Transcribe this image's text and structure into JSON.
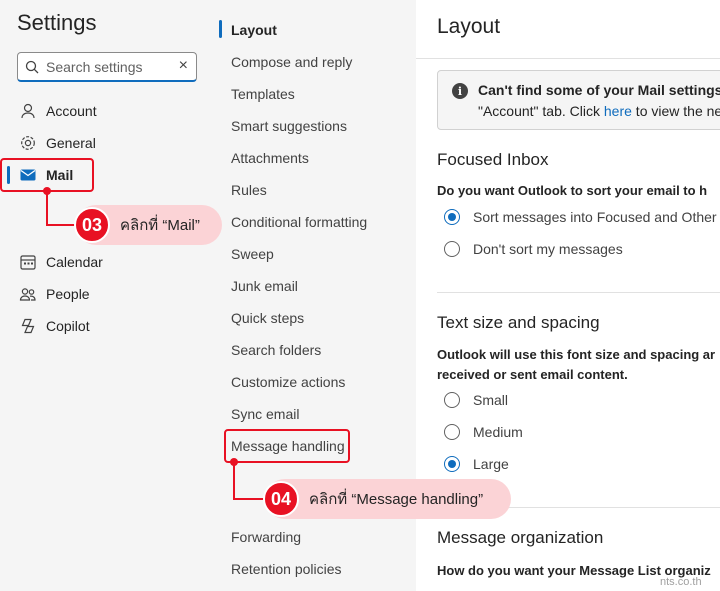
{
  "settings": {
    "title": "Settings",
    "search_placeholder": "Search settings"
  },
  "nav": {
    "account": "Account",
    "general": "General",
    "mail": "Mail",
    "calendar": "Calendar",
    "people": "People",
    "copilot": "Copilot"
  },
  "submenu": [
    "Layout",
    "Compose and reply",
    "Templates",
    "Smart suggestions",
    "Attachments",
    "Rules",
    "Conditional formatting",
    "Sweep",
    "Junk email",
    "Quick steps",
    "Search folders",
    "Customize actions",
    "Sync email",
    "Message handling",
    "Forwarding",
    "Retention policies"
  ],
  "panel": {
    "title": "Layout",
    "info": {
      "title": "Can't find some of your Mail settings?",
      "line2_pre": "\"Account\" tab. Click ",
      "line2_link": "here",
      "line2_post": " to view the ne"
    },
    "focused_inbox": {
      "title": "Focused Inbox",
      "desc": "Do you want Outlook to sort your email to h",
      "opt1": "Sort messages into Focused and Other",
      "opt2": "Don't sort my messages"
    },
    "text_size": {
      "title": "Text size and spacing",
      "desc1": "Outlook will use this font size and spacing ar",
      "desc2": "received or sent email content.",
      "opt_small": "Small",
      "opt_medium": "Medium",
      "opt_large": "Large"
    },
    "message_org": {
      "title": "Message organization",
      "desc": "How do you want your Message List organiz"
    }
  },
  "annotations": {
    "step3_num": "03",
    "step3_text": "คลิกที่ “Mail”",
    "step4_num": "04",
    "step4_text": "คลิกที่ “Message handling”"
  },
  "watermark": "nts.co.th",
  "colors": {
    "accent": "#0f6cbd",
    "annotation": "#e81123",
    "callout_bg": "#fbd3d6"
  }
}
